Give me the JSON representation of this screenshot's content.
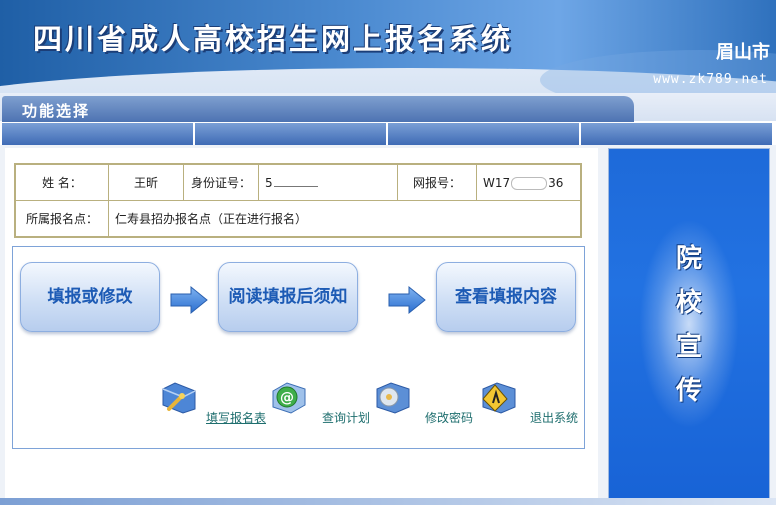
{
  "header": {
    "title": "四川省成人高校招生网上报名系统",
    "city": "眉山市",
    "url": "www.zk789.net"
  },
  "function_bar": {
    "title": "功能选择"
  },
  "info": {
    "name_label": "姓 名：",
    "name_value": "王昕",
    "id_label": "身份证号：",
    "id_value_prefix": "5",
    "reg_label": "网报号：",
    "reg_value_prefix": "W17",
    "reg_value_suffix": "36",
    "site_label": "所属报名点：",
    "site_value": "仁寿县招办报名点（正在进行报名）"
  },
  "steps": [
    {
      "label": "填报或修改"
    },
    {
      "label": "阅读填报后须知"
    },
    {
      "label": "查看填报内容"
    }
  ],
  "links": [
    {
      "label": "填写报名表",
      "icon": "folder-wrench-icon"
    },
    {
      "label": "查询计划",
      "icon": "email-at-icon"
    },
    {
      "label": "修改密码",
      "icon": "folder-cd-icon"
    },
    {
      "label": "退出系统",
      "icon": "folder-warning-icon"
    }
  ],
  "side": {
    "chars": [
      "院",
      "校",
      "宣",
      "传"
    ]
  },
  "colors": {
    "brand_blue": "#1f5fa6",
    "step_text": "#1d5bb5",
    "table_border": "#b9b07f",
    "side_panel": "#1e6ad9"
  }
}
